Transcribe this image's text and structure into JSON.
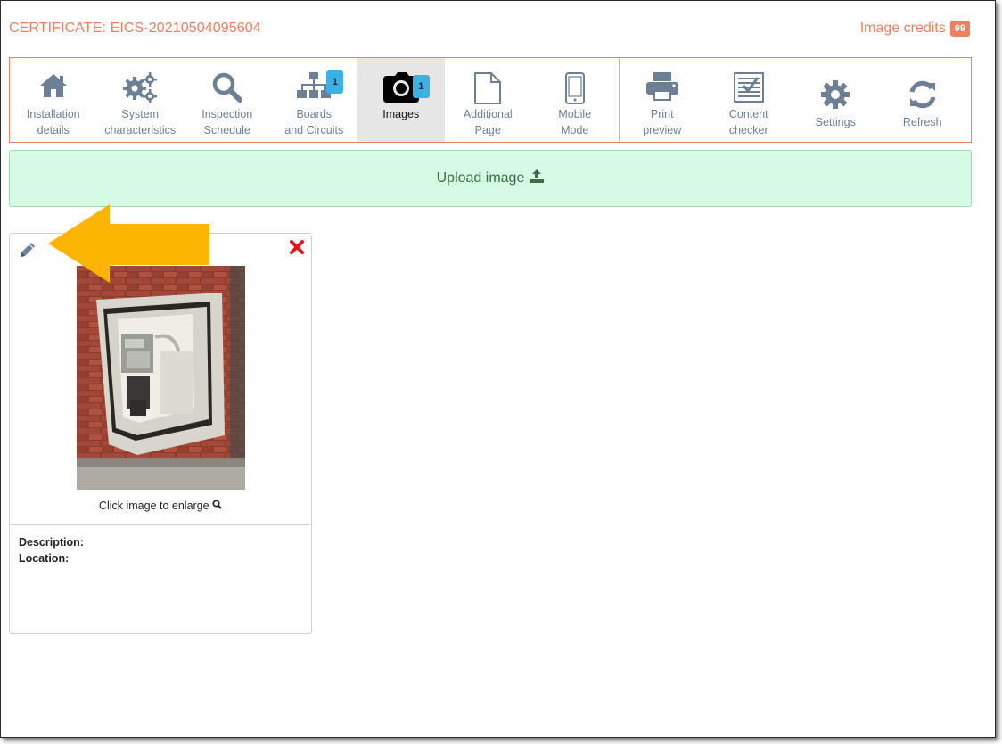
{
  "header": {
    "certificate_title": "CERTIFICATE: EICS-20210504095604",
    "credits_label": "Image credits",
    "credits_count": "99"
  },
  "toolbar": {
    "items": [
      {
        "label": "Installation\ndetails",
        "icon": "home-icon"
      },
      {
        "label": "System\ncharacteristics",
        "icon": "gears-icon"
      },
      {
        "label": "Inspection\nSchedule",
        "icon": "search-icon"
      },
      {
        "label": "Boards\nand Circuits",
        "icon": "sitemap-icon",
        "badge": "1"
      },
      {
        "label": "Images",
        "icon": "camera-icon",
        "badge": "1",
        "active": true
      },
      {
        "label": "Additional\nPage",
        "icon": "file-icon"
      },
      {
        "label": "Mobile\nMode",
        "icon": "mobile-icon"
      },
      {
        "label": "Print\npreview",
        "icon": "print-icon"
      },
      {
        "label": "Content\nchecker",
        "icon": "checklist-icon"
      },
      {
        "label": "Settings",
        "icon": "gear-icon"
      },
      {
        "label": "Refresh",
        "icon": "refresh-icon"
      }
    ]
  },
  "upload": {
    "label": "Upload image",
    "icon": "upload-icon"
  },
  "image_card": {
    "enlarge_label": "Click image to enlarge",
    "description_label": "Description:",
    "location_label": "Location:"
  },
  "colors": {
    "accent": "#ef7f5e",
    "toolbar_icon": "#6c7f95",
    "badge": "#3bb2e3",
    "upload_bg": "#d6fbe4",
    "arrow": "#fbb400",
    "delete": "#e8141c"
  }
}
